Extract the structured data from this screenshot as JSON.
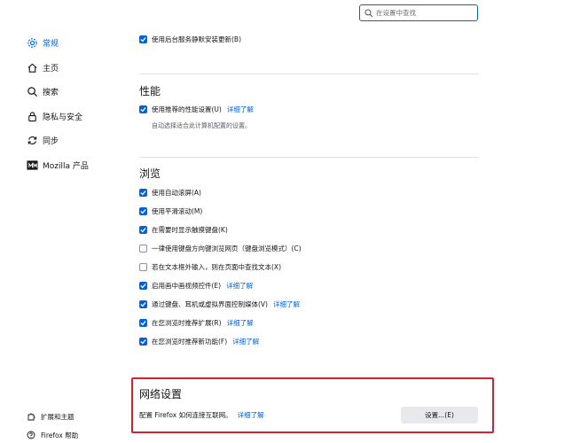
{
  "search": {
    "placeholder": "在设置中查找"
  },
  "sidebar": {
    "items": [
      {
        "label": "常规",
        "icon": "gear-icon",
        "active": true
      },
      {
        "label": "主页",
        "icon": "home-icon",
        "active": false
      },
      {
        "label": "搜索",
        "icon": "search-icon",
        "active": false
      },
      {
        "label": "隐私与安全",
        "icon": "lock-icon",
        "active": false
      },
      {
        "label": "同步",
        "icon": "sync-icon",
        "active": false
      },
      {
        "label": "Mozilla 产品",
        "icon": "mozilla-icon",
        "active": false
      }
    ],
    "footer": [
      {
        "label": "扩展和主题",
        "icon": "puzzle-icon"
      },
      {
        "label": "Firefox 帮助",
        "icon": "help-icon"
      }
    ]
  },
  "general": {
    "background_update": {
      "label": "使用后台服务静默安装更新(B)",
      "checked": true
    }
  },
  "performance": {
    "heading": "性能",
    "recommended": {
      "label": "使用推荐的性能设置(U)",
      "checked": true,
      "link": "详细了解"
    },
    "note": "自动选择适合此计算机配置的设置。"
  },
  "browsing": {
    "heading": "浏览",
    "options": [
      {
        "label": "使用自动滚屏(A)",
        "checked": true,
        "link": ""
      },
      {
        "label": "使用平滑滚动(M)",
        "checked": true,
        "link": ""
      },
      {
        "label": "在需要时显示触摸键盘(K)",
        "checked": true,
        "link": ""
      },
      {
        "label": "一律使用键盘方向键浏览网页（键盘浏览模式）(C)",
        "checked": false,
        "link": ""
      },
      {
        "label": "若在文本框外输入，则在页面中查找文本(X)",
        "checked": false,
        "link": ""
      },
      {
        "label": "启用画中画视频控件(E)",
        "checked": true,
        "link": "详细了解"
      },
      {
        "label": "通过键盘、耳机或虚拟界面控制媒体(V)",
        "checked": true,
        "link": "详细了解"
      },
      {
        "label": "在您浏览时推荐扩展(R)",
        "checked": true,
        "link": "详细了解"
      },
      {
        "label": "在您浏览时推荐新功能(F)",
        "checked": true,
        "link": "详细了解"
      }
    ]
  },
  "network": {
    "heading": "网络设置",
    "description": "配置 Firefox 如何连接互联网。",
    "link": "详细了解",
    "button": "设置...(E)"
  },
  "colors": {
    "accent": "#0061e0",
    "highlight": "#d6202e"
  }
}
